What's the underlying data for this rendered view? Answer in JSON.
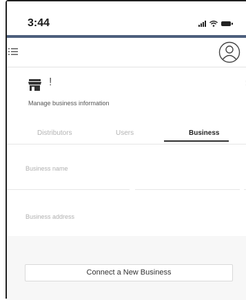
{
  "status_bar": {
    "time": "3:44",
    "icons": [
      "signal-icon",
      "wifi-icon",
      "battery-icon"
    ]
  },
  "header": {
    "menu_icon": "menu-icon",
    "avatar_icon": "user-circle-icon"
  },
  "business": {
    "title_mark": "!",
    "edge_mark": "!",
    "icon": "store-icon",
    "subtitle": "Manage business information"
  },
  "tabs": [
    {
      "label": "Distributors",
      "active": false
    },
    {
      "label": "Users",
      "active": false
    },
    {
      "label": "Business",
      "active": true
    }
  ],
  "form": {
    "business_name_label": "Business name",
    "business_address_label": "Business address"
  },
  "connect_button": {
    "label": "Connect a New Business"
  },
  "colors": {
    "header_rule": "#4d5f7d",
    "active_tab": "#222222",
    "inactive_tab": "#b3b3b3",
    "background": "#f7f7f7"
  }
}
